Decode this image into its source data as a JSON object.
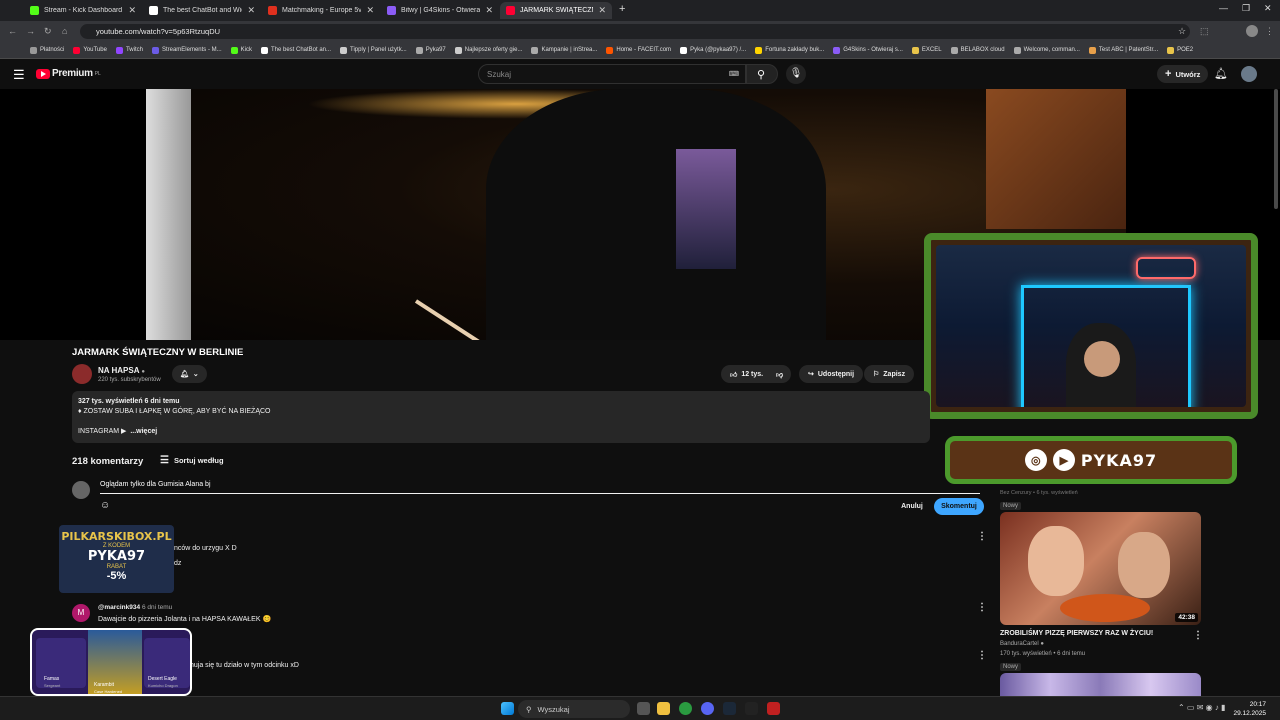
{
  "browser": {
    "tabs": [
      {
        "label": "Stream - Kick Dashboard",
        "color": "#53fc18",
        "active": false
      },
      {
        "label": "The best ChatBot and Widgets",
        "color": "#ffffff",
        "active": false
      },
      {
        "label": "Matchmaking - Europe 5v5 Qu",
        "color": "#e0301e",
        "active": false
      },
      {
        "label": "Bitwy | G4Skins - Otwieraj skrz",
        "color": "#8b5cf6",
        "active": false
      },
      {
        "label": "JARMARK ŚWIĄTECZNY W BERL",
        "color": "#ff0033",
        "active": true
      }
    ],
    "url": "youtube.com/watch?v=5p63RtzuqDU",
    "bookmarks": [
      {
        "label": "Płatności",
        "color": "#999999"
      },
      {
        "label": "YouTube",
        "color": "#ff0033"
      },
      {
        "label": "Twitch",
        "color": "#9146ff"
      },
      {
        "label": "StreamElements - M...",
        "color": "#6c5ce7"
      },
      {
        "label": "Kick",
        "color": "#53fc18"
      },
      {
        "label": "The best ChatBot an...",
        "color": "#ffffff"
      },
      {
        "label": "Tipply | Panel użytk...",
        "color": "#cccccc"
      },
      {
        "label": "Pyka97",
        "color": "#aaaaaa"
      },
      {
        "label": "Najlepsze oferty gie...",
        "color": "#cccccc"
      },
      {
        "label": "Kampanie | inStrea...",
        "color": "#aaaaaa"
      },
      {
        "label": "Home - FACEIT.com",
        "color": "#ff5500"
      },
      {
        "label": "Pyka (@pykaa97) /...",
        "color": "#ffffff"
      },
      {
        "label": "Fortuna zakłady buk...",
        "color": "#ffd400"
      },
      {
        "label": "G4Skins - Otwieraj s...",
        "color": "#8b5cf6"
      },
      {
        "label": "EXCEL",
        "color": "#e8c44a"
      },
      {
        "label": "BELABOX cloud",
        "color": "#aaaaaa"
      },
      {
        "label": "Welcome, comman...",
        "color": "#aaaaaa"
      },
      {
        "label": "Test ABC | PatentStr...",
        "color": "#e8a04a"
      },
      {
        "label": "POE2",
        "color": "#e8c44a"
      }
    ]
  },
  "youtube": {
    "logo": "Premium",
    "logo_suffix": "PL",
    "search_placeholder": "Szukaj",
    "create_label": "Utwórz"
  },
  "video": {
    "title": "JARMARK ŚWIĄTECZNY W BERLINIE",
    "channel": "NA HAPSA",
    "subscribers": "220 tys. subskrybentów",
    "likes": "12 tys.",
    "share_label": "Udostępnij",
    "save_label": "Zapisz",
    "views_date": "327 tys. wyświetleń  6 dni temu",
    "desc_line1": "♦ ZOSTAW SUBA I ŁAPKĘ W GÓRĘ, ABY BYĆ NA BIEŻĄCO",
    "desc_instagram": "INSTAGRAM ▶",
    "desc_more": "...więcej"
  },
  "comments": {
    "count": "218 komentarzy",
    "sort_label": "Sortuj według",
    "draft": "Oglądam tylko dla Gumisia Alana bj",
    "cancel_label": "Anuluj",
    "submit_label": "Skomentuj",
    "items": [
      {
        "author": "",
        "time": "",
        "text": "nców do urzygu  X D",
        "extra": "dz"
      },
      {
        "author": "@marcink934",
        "time": "6 dni temu",
        "text": "Dawajcie do pizzeria Jolanta i na HAPSA KAWAŁEK 😊",
        "extra": ""
      },
      {
        "author": "",
        "time": "",
        "text": "huja się tu działo w tym odcinku xD",
        "extra": ""
      }
    ]
  },
  "overlay": {
    "handle": "PYKA97",
    "promo_site": "PILKARSKIBOX.PL",
    "promo_code_label": "Z KODEM",
    "promo_code": "PYKA97",
    "promo_discount_label": "RABAT",
    "promo_discount": "-5%",
    "skins": [
      "Famas",
      "Karambit",
      "Desert Eagle"
    ],
    "skin_sub": [
      "Sergeant",
      "Case Hardened",
      "Kumicho Dragon"
    ]
  },
  "recommendation": {
    "meta_top": "Bez Cenzury • 6 tys. wyświetleń",
    "new_badge": "Nowy",
    "title": "ZROBILIŚMY PIZZĘ PIERWSZY RAZ W ŻYCIU!",
    "channel": "BanduraCartel",
    "meta": "170 tys. wyświetleń • 6 dni temu",
    "duration": "42:38",
    "new_badge2": "Nowy"
  },
  "taskbar": {
    "search_label": "Wyszukaj",
    "time": "20:17",
    "date": "29.12.2025"
  }
}
